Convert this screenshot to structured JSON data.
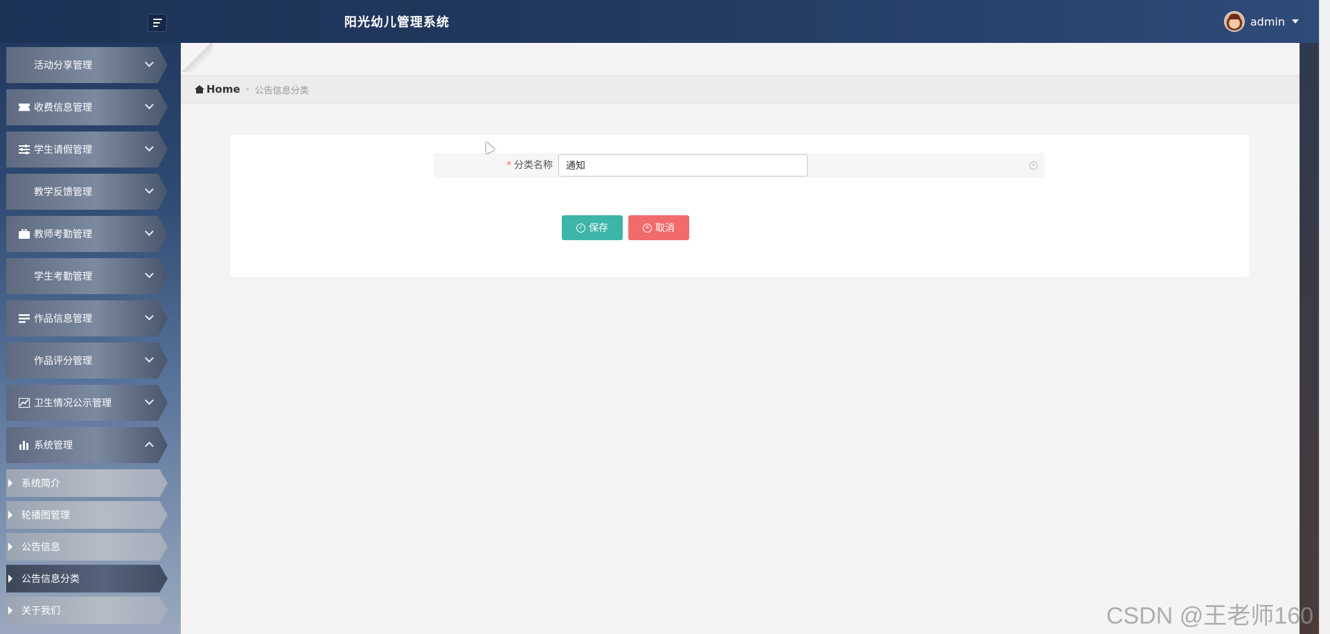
{
  "header": {
    "app_title": "阳光幼儿管理系统",
    "user": {
      "name": "admin"
    }
  },
  "sidebar": {
    "items": [
      {
        "label": "活动分享管理",
        "icon": "grid-icon"
      },
      {
        "label": "收费信息管理",
        "icon": "ticket-icon"
      },
      {
        "label": "学生请假管理",
        "icon": "sliders-icon"
      },
      {
        "label": "教学反馈管理",
        "icon": "grid-icon"
      },
      {
        "label": "教师考勤管理",
        "icon": "briefcase-icon"
      },
      {
        "label": "学生考勤管理",
        "icon": "grid-icon"
      },
      {
        "label": "作品信息管理",
        "icon": "list-icon"
      },
      {
        "label": "作品评分管理",
        "icon": "grid-icon"
      },
      {
        "label": "卫生情况公示管理",
        "icon": "chart-line-icon"
      },
      {
        "label": "系统管理",
        "icon": "bar-chart-icon",
        "expanded": true
      }
    ],
    "sub_items": [
      {
        "label": "系统简介"
      },
      {
        "label": "轮播图管理"
      },
      {
        "label": "公告信息"
      },
      {
        "label": "公告信息分类",
        "active": true
      },
      {
        "label": "关于我们"
      }
    ]
  },
  "breadcrumb": {
    "home": "Home",
    "separator": "-",
    "current": "公告信息分类"
  },
  "form": {
    "required_mark": "*",
    "field_label": "分类名称",
    "field_value": "通知",
    "save_label": "保存",
    "cancel_label": "取消"
  },
  "watermark": "CSDN @王老师160",
  "colors": {
    "save": "#3db5a8",
    "cancel": "#f26b6b",
    "header": "#22395f"
  }
}
